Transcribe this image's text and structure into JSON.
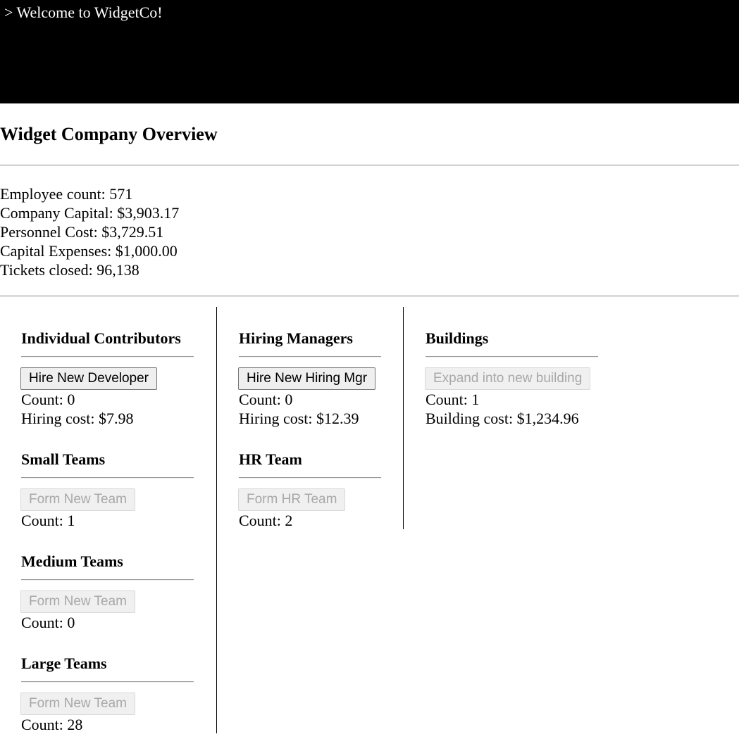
{
  "console": {
    "text": "> Welcome to WidgetCo!"
  },
  "overview": {
    "title": "Widget Company Overview",
    "stats": [
      {
        "label": "Employee count:",
        "value": "571"
      },
      {
        "label": "Company Capital:",
        "value": "$3,903.17"
      },
      {
        "label": "Personnel Cost:",
        "value": "$3,729.51"
      },
      {
        "label": "Capital Expenses:",
        "value": "$1,000.00"
      },
      {
        "label": "Tickets closed:",
        "value": "96,138"
      }
    ]
  },
  "sections": {
    "individual_contributors": {
      "title": "Individual Contributors",
      "button": "Hire New Developer",
      "button_enabled": true,
      "count_label": "Count:",
      "count": "0",
      "cost_label": "Hiring cost:",
      "cost": "$7.98"
    },
    "small_teams": {
      "title": "Small Teams",
      "button": "Form New Team",
      "button_enabled": false,
      "count_label": "Count:",
      "count": "1"
    },
    "medium_teams": {
      "title": "Medium Teams",
      "button": "Form New Team",
      "button_enabled": false,
      "count_label": "Count:",
      "count": "0"
    },
    "large_teams": {
      "title": "Large Teams",
      "button": "Form New Team",
      "button_enabled": false,
      "count_label": "Count:",
      "count": "28"
    },
    "hiring_managers": {
      "title": "Hiring Managers",
      "button": "Hire New Hiring Mgr",
      "button_enabled": true,
      "count_label": "Count:",
      "count": "0",
      "cost_label": "Hiring cost:",
      "cost": "$12.39"
    },
    "hr_team": {
      "title": "HR Team",
      "button": "Form HR Team",
      "button_enabled": false,
      "count_label": "Count:",
      "count": "2"
    },
    "buildings": {
      "title": "Buildings",
      "button": "Expand into new building",
      "button_enabled": false,
      "count_label": "Count:",
      "count": "1",
      "cost_label": "Building cost:",
      "cost": "$1,234.96"
    }
  }
}
